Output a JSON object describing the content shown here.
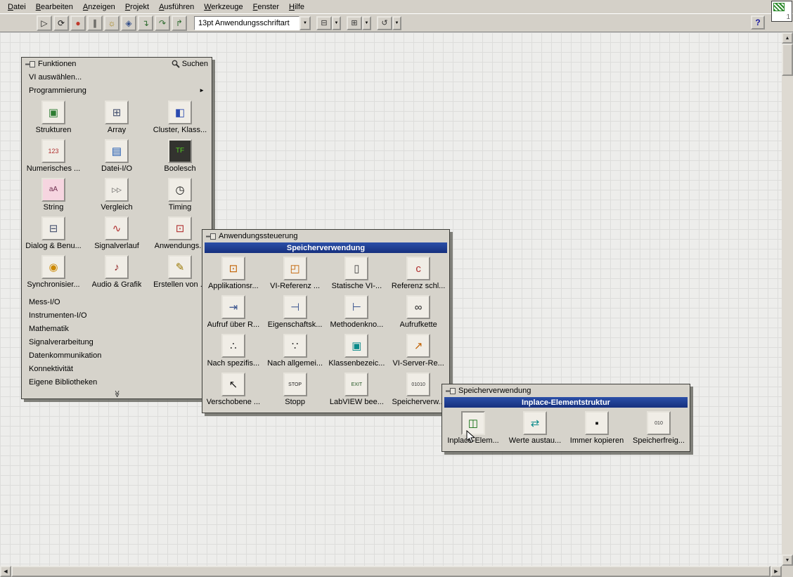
{
  "app": {
    "help_label": "?",
    "vi_icon_badge": "1"
  },
  "glyphs": {
    "up": "▲",
    "down": "▼",
    "left": "◀",
    "right": "▶",
    "dropdown": "▼",
    "submenu": "►",
    "expand": "≫"
  },
  "menubar": {
    "items": [
      {
        "name": "menu-datei",
        "label": "Datei"
      },
      {
        "name": "menu-bearbeiten",
        "label": "Bearbeiten"
      },
      {
        "name": "menu-anzeigen",
        "label": "Anzeigen"
      },
      {
        "name": "menu-projekt",
        "label": "Projekt"
      },
      {
        "name": "menu-ausfuehren",
        "label": "Ausführen"
      },
      {
        "name": "menu-werkzeuge",
        "label": "Werkzeuge"
      },
      {
        "name": "menu-fenster",
        "label": "Fenster"
      },
      {
        "name": "menu-hilfe",
        "label": "Hilfe"
      }
    ]
  },
  "toolbar": {
    "buttons": [
      {
        "name": "run-button",
        "glyph": "▷",
        "color": "#1a1a1a"
      },
      {
        "name": "run-continuous-button",
        "glyph": "⟳",
        "color": "#1a1a1a"
      },
      {
        "name": "abort-button",
        "glyph": "●",
        "color": "#c0392b"
      },
      {
        "name": "pause-button",
        "glyph": "∥",
        "color": "#1a1a1a"
      },
      {
        "name": "highlight-execution-button",
        "glyph": "☼",
        "color": "#a07800"
      },
      {
        "name": "retain-wire-values-button",
        "glyph": "◈",
        "color": "#35508c"
      },
      {
        "name": "step-into-button",
        "glyph": "↴",
        "color": "#2f6b2f"
      },
      {
        "name": "step-over-button",
        "glyph": "↷",
        "color": "#2f6b2f"
      },
      {
        "name": "step-out-button",
        "glyph": "↱",
        "color": "#2f6b2f"
      }
    ],
    "font_selector": {
      "value": "13pt Anwendungsschriftart"
    },
    "dropdowns": [
      {
        "name": "align-objects-dropdown",
        "glyph": "⊟",
        "color": "#333333"
      },
      {
        "name": "distribute-objects-dropdown",
        "glyph": "⊞",
        "color": "#333333"
      },
      {
        "name": "reorder-dropdown",
        "glyph": "↺",
        "color": "#333333"
      }
    ]
  },
  "palettes": {
    "funktionen": {
      "title": "Funktionen",
      "search_label": "Suchen",
      "vi_auswaehlen": "VI auswählen...",
      "programmierung": "Programmierung",
      "grid": [
        {
          "name": "strukturen",
          "icon": "strukturen-icon",
          "label": "Strukturen",
          "glyph": "▣",
          "color": "#2e7d32"
        },
        {
          "name": "array",
          "icon": "array-icon",
          "label": "Array",
          "glyph": "⊞",
          "color": "#44506e"
        },
        {
          "name": "cluster-klasse",
          "icon": "cluster-icon",
          "label": "Cluster, Klass...",
          "glyph": "◧",
          "color": "#2b4bb0"
        },
        {
          "name": "numerisch",
          "icon": "numerisch-icon",
          "label": "Numerisches ...",
          "glyph": "123",
          "color": "#b03030",
          "fsz": "9px"
        },
        {
          "name": "datei-io",
          "icon": "datei-io-icon",
          "label": "Datei-I/O",
          "glyph": "▤",
          "color": "#1a56b0"
        },
        {
          "name": "boolesch",
          "icon": "boolesch-icon",
          "label": "Boolesch",
          "glyph": "TF",
          "color": "#55cc22",
          "bg": "#33332f",
          "fsz": "10px"
        },
        {
          "name": "string",
          "icon": "string-icon",
          "label": "String",
          "glyph": "aA",
          "color": "#703050",
          "bg": "#f6d5e0",
          "fsz": "10px"
        },
        {
          "name": "vergleich",
          "icon": "vergleich-icon",
          "label": "Vergleich",
          "glyph": "▷▷",
          "color": "#444444",
          "fsz": "9px"
        },
        {
          "name": "timing",
          "icon": "timing-icon",
          "label": "Timing",
          "glyph": "◷",
          "color": "#111111"
        },
        {
          "name": "dialog-benutzer",
          "icon": "dialog-icon",
          "label": "Dialog & Benu...",
          "glyph": "⊟",
          "color": "#44506e"
        },
        {
          "name": "signalverlauf",
          "icon": "signalverlauf-icon",
          "label": "Signalverlauf",
          "glyph": "∿",
          "color": "#b03030"
        },
        {
          "name": "anwendungssteuerung",
          "icon": "anwendungssteuerung-icon",
          "label": "Anwendungs...",
          "glyph": "⊡",
          "color": "#b03030"
        },
        {
          "name": "synchronisierung",
          "icon": "synchronisierung-icon",
          "label": "Synchronisier...",
          "glyph": "◉",
          "color": "#cc8800"
        },
        {
          "name": "audio-grafik",
          "icon": "audio-grafik-icon",
          "label": "Audio & Grafik",
          "glyph": "♪",
          "color": "#8b1a1a"
        },
        {
          "name": "erstellen-von",
          "icon": "erstellen-von-icon",
          "label": "Erstellen von ...",
          "glyph": "✎",
          "color": "#997700"
        }
      ],
      "categories": [
        {
          "name": "mess-io-item",
          "label": "Mess-I/O"
        },
        {
          "name": "instrumenten-io-item",
          "label": "Instrumenten-I/O"
        },
        {
          "name": "mathematik-item",
          "label": "Mathematik"
        },
        {
          "name": "signalverarbeitung-item",
          "label": "Signalverarbeitung"
        },
        {
          "name": "datenkommunikation-item",
          "label": "Datenkommunikation"
        },
        {
          "name": "konnektivitaet-item",
          "label": "Konnektivität"
        },
        {
          "name": "eigene-bibliotheken-item",
          "label": "Eigene Bibliotheken"
        }
      ]
    },
    "anwendungssteuerung": {
      "title": "Anwendungssteuerung",
      "header": "Speicherverwendung",
      "grid": [
        {
          "name": "applikationsreferenz",
          "icon": "applikationsreferenz-icon",
          "label": "Applikationsr...",
          "glyph": "⊡",
          "color": "#c06000"
        },
        {
          "name": "vi-referenz",
          "icon": "vi-referenz-icon",
          "label": "VI-Referenz ...",
          "glyph": "◰",
          "color": "#c06000"
        },
        {
          "name": "statische-vi-referenz",
          "icon": "statische-vi-referenz-icon",
          "label": "Statische VI-...",
          "glyph": "▯",
          "color": "#444444"
        },
        {
          "name": "referenz-schliessen",
          "icon": "referenz-schliessen-icon",
          "label": "Referenz schl...",
          "glyph": "c",
          "color": "#b03030"
        },
        {
          "name": "aufruf-ueber-referenz",
          "icon": "aufruf-ueber-referenz-icon",
          "label": "Aufruf über R...",
          "glyph": "⇥",
          "color": "#35508c"
        },
        {
          "name": "eigenschaftsknoten",
          "icon": "eigenschaftsknoten-icon",
          "label": "Eigenschaftsk...",
          "glyph": "⊣",
          "color": "#35508c"
        },
        {
          "name": "methodenknoten",
          "icon": "methodenknoten-icon",
          "label": "Methodenkno...",
          "glyph": "⊢",
          "color": "#35508c"
        },
        {
          "name": "aufrufkette",
          "icon": "aufrufkette-icon",
          "label": "Aufrufkette",
          "glyph": "∞",
          "color": "#222222"
        },
        {
          "name": "nach-spezifischer-instanz",
          "icon": "nach-spezifischer-instanz-icon",
          "label": "Nach spezifis...",
          "glyph": "∴",
          "color": "#333333"
        },
        {
          "name": "nach-allgemeinen",
          "icon": "nach-allgemeinen-icon",
          "label": "Nach allgemei...",
          "glyph": "∵",
          "color": "#333333"
        },
        {
          "name": "klassenbezeichnung",
          "icon": "klassenbezeichnung-icon",
          "label": "Klassenbezeic...",
          "glyph": "▣",
          "color": "#0a8a8a"
        },
        {
          "name": "vi-server-referenz",
          "icon": "vi-server-referenz-icon",
          "label": "VI-Server-Re...",
          "glyph": "↗",
          "color": "#c06000"
        },
        {
          "name": "verschobene",
          "icon": "verschobene-icon",
          "label": "Verschobene ...",
          "glyph": "↖",
          "color": "#111111"
        },
        {
          "name": "stopp",
          "icon": "stopp-icon",
          "label": "Stopp",
          "glyph": "STOP",
          "color": "#222222",
          "fsz": "7px"
        },
        {
          "name": "labview-beenden",
          "icon": "labview-beenden-icon",
          "label": "LabVIEW bee...",
          "glyph": "EXIT",
          "color": "#225522",
          "fsz": "7px"
        },
        {
          "name": "speicherverwendung",
          "icon": "speicherverwendung-icon",
          "label": "Speicherverw...",
          "glyph": "01010",
          "color": "#333333",
          "fsz": "7px"
        }
      ]
    },
    "speicherverwendung": {
      "title": "Speicherverwendung",
      "header": "Inplace-Elementstruktur",
      "grid": [
        {
          "name": "inplace-elementstruktur",
          "icon": "inplace-elementstruktur-icon",
          "label": "Inplace-Elem...",
          "glyph": "◫",
          "color": "#0a6a0a",
          "border": "inset"
        },
        {
          "name": "werte-austauschen",
          "icon": "werte-austauschen-icon",
          "label": "Werte austau...",
          "glyph": "⇄",
          "color": "#0a8a8a"
        },
        {
          "name": "immer-kopieren",
          "icon": "immer-kopieren-icon",
          "label": "Immer kopieren",
          "glyph": "▪",
          "color": "#111111"
        },
        {
          "name": "speicherfreigabe",
          "icon": "speicherfreigabe-icon",
          "label": "Speicherfreig...",
          "glyph": "010",
          "color": "#333333",
          "fsz": "7px"
        }
      ]
    }
  }
}
